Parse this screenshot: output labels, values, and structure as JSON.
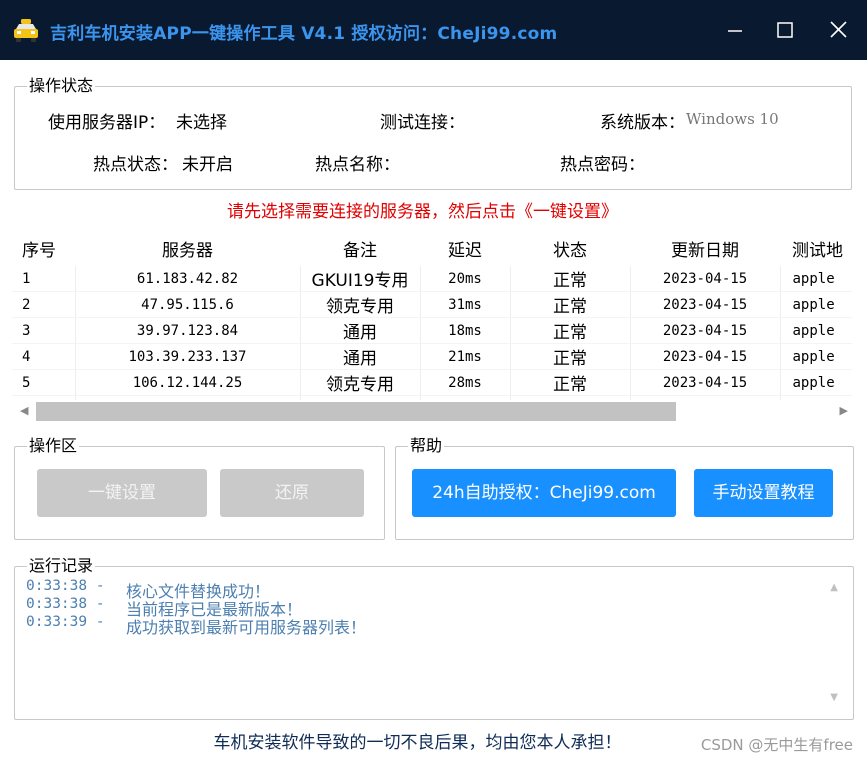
{
  "window": {
    "title": "吉利车机安装APP一键操作工具 V4.1 授权访问：CheJi99.com",
    "minimize_icon": "minimize-icon",
    "maximize_icon": "maximize-icon",
    "close_icon": "close-icon"
  },
  "status_group": {
    "legend": "操作状态",
    "server_ip_label": "使用服务器IP：",
    "server_ip_value": "未选择",
    "test_conn_label": "测试连接：",
    "test_conn_value": "",
    "sys_version_label": "系统版本：",
    "sys_version_value": "Windows 10",
    "hotspot_status_label": "热点状态：",
    "hotspot_status_value": "未开启",
    "hotspot_name_label": "热点名称：",
    "hotspot_name_value": "",
    "hotspot_pwd_label": "热点密码：",
    "hotspot_pwd_value": ""
  },
  "warning_text": "请先选择需要连接的服务器，然后点击《一键设置》",
  "server_table": {
    "columns": [
      "序号",
      "服务器",
      "备注",
      "延迟",
      "状态",
      "更新日期",
      "测试地"
    ],
    "rows": [
      [
        "1",
        "61.183.42.82",
        "GKUI19专用",
        "20ms",
        "正常",
        "2023-04-15",
        "apple"
      ],
      [
        "2",
        "47.95.115.6",
        "领克专用",
        "31ms",
        "正常",
        "2023-04-15",
        "apple"
      ],
      [
        "3",
        "39.97.123.84",
        "通用",
        "18ms",
        "正常",
        "2023-04-15",
        "apple"
      ],
      [
        "4",
        "103.39.233.137",
        "通用",
        "21ms",
        "正常",
        "2023-04-15",
        "apple"
      ],
      [
        "5",
        "106.12.144.25",
        "领克专用",
        "28ms",
        "正常",
        "2023-04-15",
        "apple"
      ]
    ]
  },
  "ops_group": {
    "legend": "操作区",
    "one_click_label": "一键设置",
    "restore_label": "还原"
  },
  "help_group": {
    "legend": "帮助",
    "auth_button_label": "24h自助授权：CheJi99.com",
    "manual_button_label": "手动设置教程"
  },
  "log_group": {
    "legend": "运行记录",
    "entries": [
      {
        "time": "0:33:38 -",
        "message": "核心文件替换成功！"
      },
      {
        "time": "0:33:38 -",
        "message": "当前程序已是最新版本！"
      },
      {
        "time": "0:33:39 -",
        "message": "成功获取到最新可用服务器列表！"
      }
    ]
  },
  "footer_text": "车机安装软件导致的一切不良后果，均由您本人承担！",
  "watermark": "CSDN @无中生有free",
  "colors": {
    "titlebar_bg": "#09192f",
    "title_text": "#3b95ee",
    "warning": "#e00000",
    "primary_button": "#1890ff",
    "disabled_button": "#c9c9c9",
    "log_text": "#4d7fb0"
  }
}
